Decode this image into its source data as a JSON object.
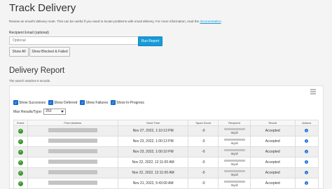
{
  "page": {
    "title": "Track Delivery",
    "description": "Review an email's delivery route. This can be useful if you need to locate problems with email delivery. For more information, read the",
    "doc_link": "documentation",
    "recipient_label": "Recipient Email (optional)",
    "recipient_placeholder": "Optional",
    "run_report": "Run Report",
    "show_all": "Show All",
    "show_blocked_failed": "Show Blocked & Failed"
  },
  "report": {
    "title": "Delivery Report",
    "matches": "The search matches 6 records.",
    "filters": {
      "successes": "Show Successes",
      "deferred": "Show Deferred",
      "failures": "Show Failures",
      "in_progress": "Show In-Progress"
    },
    "max_label": "Max Results/Type:",
    "max_value": "250",
    "columns": [
      "Event",
      "From Address",
      "Send Time",
      "Spam Score",
      "Recipient",
      "Result",
      "Actions"
    ],
    "rows": [
      {
        "time": "Nov 27, 2022, 1:10:13 PM",
        "spam": "-0",
        "recipient": "my.id",
        "result": "Accepted"
      },
      {
        "time": "Nov 23, 2022, 1:00:13 PM",
        "spam": "-0",
        "recipient": "my.id",
        "result": "Accepted"
      },
      {
        "time": "Nov 23, 2022, 1:00:10 PM",
        "spam": "-0",
        "recipient": "my.id",
        "result": "Accepted"
      },
      {
        "time": "Nov 22, 2022, 12:11:00 AM",
        "spam": "-0",
        "recipient": "my.id",
        "result": "Accepted"
      },
      {
        "time": "Nov 22, 2022, 12:11:00 AM",
        "spam": "-0",
        "recipient": "my.id",
        "result": "Accepted"
      },
      {
        "time": "Nov 21, 2022, 5:43:00 AM",
        "spam": "-0",
        "recipient": "my.id",
        "result": "Accepted"
      }
    ]
  },
  "icons": {
    "success": "check-circle-icon",
    "info": "info-icon",
    "columns": "column-list-icon"
  },
  "colors": {
    "primary": "#179bd7",
    "success": "#3c9a2e",
    "info": "#1e73d8"
  }
}
